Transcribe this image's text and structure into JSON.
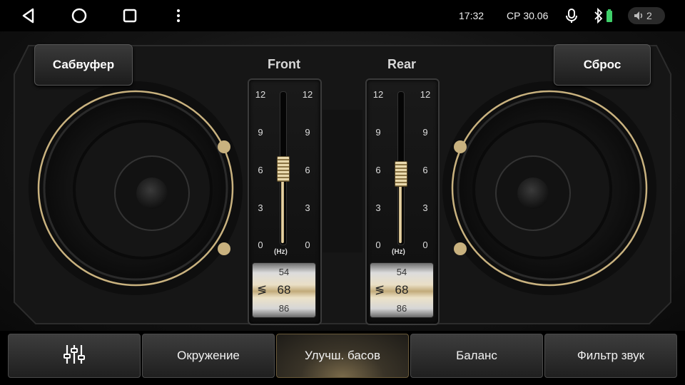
{
  "statusbar": {
    "time": "17:32",
    "date": "СР 30.06",
    "volume_level": "2",
    "icons": [
      "back-icon",
      "home-icon",
      "recents-icon",
      "more-vert-icon",
      "mic-icon",
      "bluetooth-icon",
      "battery-icon",
      "volume-icon"
    ]
  },
  "top_buttons": {
    "subwoofer": "Сабвуфер",
    "reset": "Сброс"
  },
  "front": {
    "title": "Front",
    "scale_left": [
      "12",
      "9",
      "6",
      "3",
      "0"
    ],
    "scale_right": [
      "12",
      "9",
      "6",
      "3",
      "0"
    ],
    "unit": "(Hz)",
    "level": 6.0,
    "drum_prev": "54",
    "drum_value": "68",
    "drum_next": "86"
  },
  "rear": {
    "title": "Rear",
    "scale_left": [
      "12",
      "9",
      "6",
      "3",
      "0"
    ],
    "scale_right": [
      "12",
      "9",
      "6",
      "3",
      "0"
    ],
    "unit": "(Hz)",
    "level": 5.6,
    "drum_prev": "54",
    "drum_value": "68",
    "drum_next": "86"
  },
  "tabs": [
    {
      "label": "",
      "icon": "equalizer-icon"
    },
    {
      "label": "Окружение"
    },
    {
      "label": "Улучш. басов",
      "active": true
    },
    {
      "label": "Баланс"
    },
    {
      "label": "Фильтр звук"
    }
  ],
  "colors": {
    "accent_gold": "#c9b27f",
    "background": "#0d0d0d"
  }
}
